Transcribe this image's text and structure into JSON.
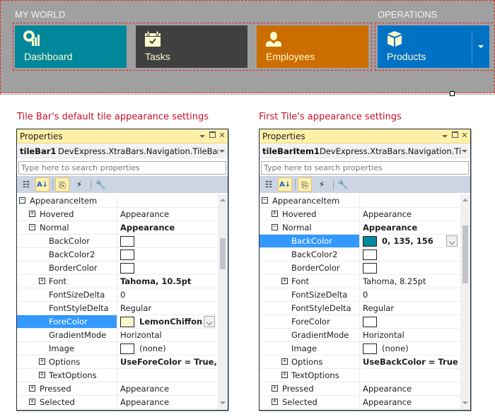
{
  "tilebar": {
    "groups": [
      {
        "label": "MY WORLD"
      },
      {
        "label": "OPERATIONS"
      }
    ],
    "tiles": [
      {
        "label": "Dashboard",
        "icon": "dashboard-chart-icon",
        "color": "#00879c"
      },
      {
        "label": "Tasks",
        "icon": "calendar-check-icon",
        "color": "#404040"
      },
      {
        "label": "Employees",
        "icon": "person-icon",
        "color": "#cc6d00"
      },
      {
        "label": "Products",
        "icon": "box-icon",
        "color": "#0072c6",
        "has_dropdown": true
      }
    ],
    "background": "#a0a0a0"
  },
  "captions": {
    "left": "Tile Bar's default tile appearance settings",
    "right": "First Tile's appearance settings"
  },
  "panels": [
    {
      "title": "Properties",
      "object_name": "tileBar1",
      "object_type": "DevExpress.XtraBars.Navigation.TileBar",
      "search_placeholder": "Type here to search properties",
      "rows": [
        {
          "name": "AppearanceItem",
          "value": "",
          "level": 0,
          "expander": "minus"
        },
        {
          "name": "Hovered",
          "value": "Appearance",
          "level": 1,
          "expander": "plus"
        },
        {
          "name": "Normal",
          "value": "Appearance",
          "level": 1,
          "expander": "minus",
          "bold": true
        },
        {
          "name": "BackColor",
          "value": "",
          "level": 2,
          "swatch": "#ffffff"
        },
        {
          "name": "BackColor2",
          "value": "",
          "level": 2,
          "swatch": "#ffffff"
        },
        {
          "name": "BorderColor",
          "value": "",
          "level": 2,
          "swatch": "#ffffff"
        },
        {
          "name": "Font",
          "value": "Tahoma, 10.5pt",
          "level": 2,
          "expander": "plus",
          "bold": true
        },
        {
          "name": "FontSizeDelta",
          "value": "0",
          "level": 2
        },
        {
          "name": "FontStyleDelta",
          "value": "Regular",
          "level": 2
        },
        {
          "name": "ForeColor",
          "value": "LemonChiffon",
          "level": 2,
          "swatch": "#fffacd",
          "bold": true,
          "selected": true
        },
        {
          "name": "GradientMode",
          "value": "Horizontal",
          "level": 2
        },
        {
          "name": "Image",
          "value": "(none)",
          "level": 2,
          "swatch": "#ffffff"
        },
        {
          "name": "Options",
          "value": "UseForeColor = True, UseFont = True",
          "level": 2,
          "expander": "plus",
          "bold": true
        },
        {
          "name": "TextOptions",
          "value": "",
          "level": 2,
          "expander": "plus"
        },
        {
          "name": "Pressed",
          "value": "Appearance",
          "level": 1,
          "expander": "plus"
        },
        {
          "name": "Selected",
          "value": "Appearance",
          "level": 1,
          "expander": "plus"
        }
      ],
      "scroll_position": 0.25
    },
    {
      "title": "Properties",
      "object_name": "tileBarItem1",
      "object_type": "DevExpress.XtraBars.Navigation.TileBarItem",
      "search_placeholder": "Type here to search properties",
      "rows": [
        {
          "name": "AppearanceItem",
          "value": "",
          "level": 0,
          "expander": "minus"
        },
        {
          "name": "Hovered",
          "value": "Appearance",
          "level": 1,
          "expander": "plus"
        },
        {
          "name": "Normal",
          "value": "Appearance",
          "level": 1,
          "expander": "minus",
          "bold": true
        },
        {
          "name": "BackColor",
          "value": "0, 135, 156",
          "level": 2,
          "swatch": "#00879c",
          "bold": true,
          "selected": true
        },
        {
          "name": "BackColor2",
          "value": "",
          "level": 2,
          "swatch": "#ffffff"
        },
        {
          "name": "BorderColor",
          "value": "",
          "level": 2,
          "swatch": "#ffffff"
        },
        {
          "name": "Font",
          "value": "Tahoma, 8.25pt",
          "level": 2,
          "expander": "plus"
        },
        {
          "name": "FontSizeDelta",
          "value": "0",
          "level": 2
        },
        {
          "name": "FontStyleDelta",
          "value": "Regular",
          "level": 2
        },
        {
          "name": "ForeColor",
          "value": "",
          "level": 2,
          "swatch": "#ffffff"
        },
        {
          "name": "GradientMode",
          "value": "Horizontal",
          "level": 2
        },
        {
          "name": "Image",
          "value": "(none)",
          "level": 2,
          "swatch": "#ffffff"
        },
        {
          "name": "Options",
          "value": "UseBackColor = True",
          "level": 2,
          "expander": "plus",
          "bold": true
        },
        {
          "name": "TextOptions",
          "value": "",
          "level": 2,
          "expander": "plus"
        },
        {
          "name": "Pressed",
          "value": "Appearance",
          "level": 1,
          "expander": "plus"
        },
        {
          "name": "Selected",
          "value": "Appearance",
          "level": 1,
          "expander": "plus"
        }
      ],
      "scroll_position": 0.15
    }
  ],
  "colors": {
    "selection": "#3399ff",
    "caption": "#c8102e",
    "panel_header": "#fff0a8",
    "toolbar": "#ccd5e4"
  }
}
